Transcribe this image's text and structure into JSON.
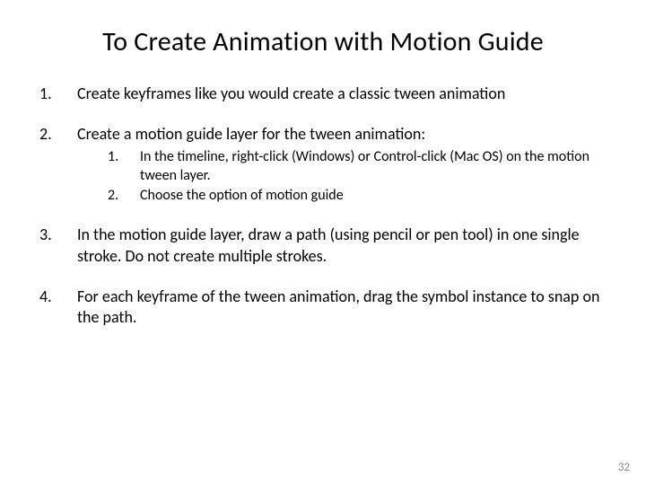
{
  "title": "To Create Animation with Motion Guide",
  "steps": [
    {
      "text": "Create keyframes like you would create a classic tween animation"
    },
    {
      "text": "Create a motion guide layer for the tween animation:",
      "substeps": [
        "In the timeline, right-click (Windows) or Control-click (Mac OS) on the motion tween layer.",
        "Choose the option of motion guide"
      ]
    },
    {
      "text": "In the motion guide layer, draw a path (using pencil or pen tool) in one single stroke.\nDo not create multiple strokes."
    },
    {
      "text": "For each keyframe of the tween animation, drag the symbol instance to snap on the path."
    }
  ],
  "pageNumber": "32"
}
